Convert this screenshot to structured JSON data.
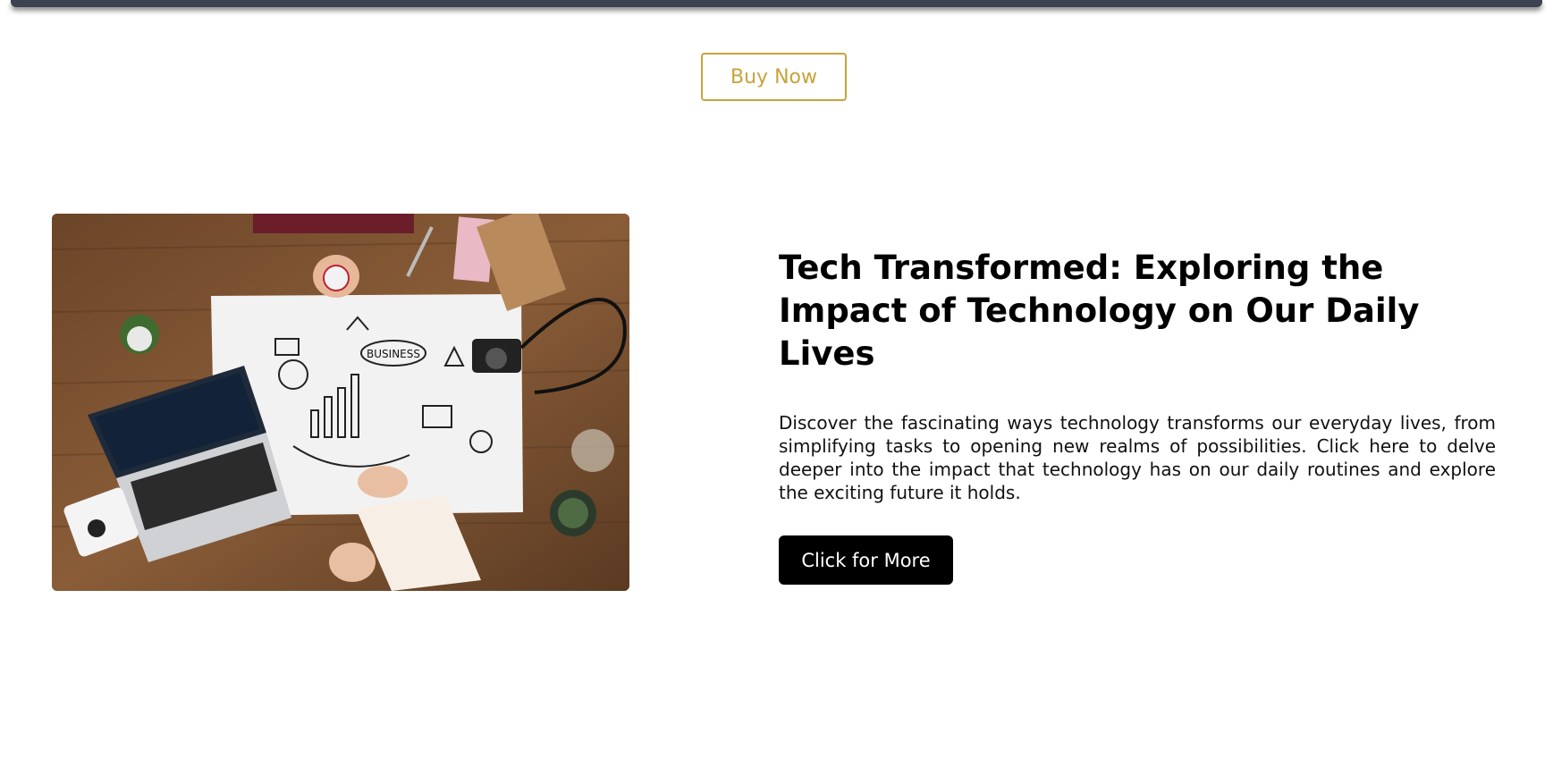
{
  "header": {
    "buy_now_label": "Buy Now"
  },
  "feature": {
    "title": "Tech Transformed: Exploring the Impact of Technology on Our Daily Lives",
    "description": "Discover the fascinating ways technology transforms our everyday lives, from simplifying tasks to opening new realms of possibilities. Click here to delve deeper into the impact that technology has on our daily routines and explore the exciting future it holds.",
    "button_label": "Click for More",
    "image_label": "BUSINESS"
  },
  "colors": {
    "accent_gold": "#c7a33b",
    "button_black": "#000000",
    "top_bar": "#3c4250"
  }
}
